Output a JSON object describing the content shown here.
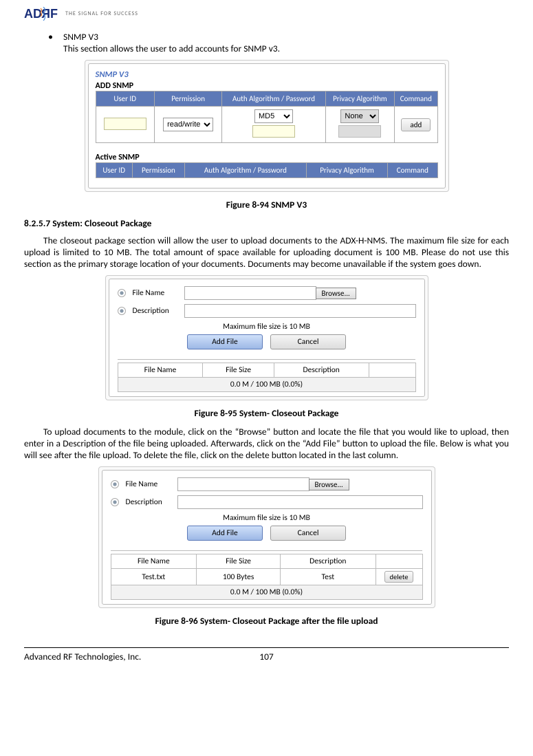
{
  "header": {
    "logo_text": "ADRF",
    "tagline": "THE SIGNAL FOR SUCCESS"
  },
  "section1": {
    "bullet_title": "SNMP V3",
    "bullet_body": "This section allows the user to add accounts for SNMP v3."
  },
  "snmp_panel": {
    "title": "SNMP V3",
    "add_label": "ADD SNMP",
    "headers": [
      "User ID",
      "Permission",
      "Auth Algorithm / Password",
      "Privacy Algorithm",
      "Command"
    ],
    "perm_value": "read/write",
    "auth_value": "MD5",
    "priv_value": "None",
    "add_btn": "add",
    "active_label": "Active SNMP"
  },
  "fig1": "Figure 8-94    SNMP V3",
  "section2": {
    "heading": "8.2.5.7    System: Closeout Package",
    "para": "The closeout package section will allow the user to upload documents to the ADX-H-NMS.  The maximum file size for each upload is limited to 10 MB.  The total amount of space available for uploading document is 100 MB.  Please do not use this section as the primary storage location of your documents.   Documents may become unavailable if the system goes down."
  },
  "closeout": {
    "file_label": "File Name",
    "desc_label": "Description",
    "browse": "Browse...",
    "max_text": "Maximum file size is 10 MB",
    "add_btn": "Add File",
    "cancel_btn": "Cancel",
    "cols": [
      "File Name",
      "File Size",
      "Description"
    ],
    "usage": "0.0 M / 100 MB (0.0%)"
  },
  "fig2": "Figure 8-95    System- Closeout Package",
  "para2": "To upload documents to the module, click on the “Browse” button and locate the file that you would like to upload, then enter in a Description of the file being uploaded.  Afterwards, click on the “Add File” button to upload the file.  Below is what you will see after the file upload.  To delete the file, click on the delete button located in the last column.",
  "closeout2": {
    "row": {
      "name": "Test.txt",
      "size": "100 Bytes",
      "desc": "Test"
    },
    "delete_btn": "delete"
  },
  "fig3": "Figure 8-96    System- Closeout Package after the file upload",
  "footer": {
    "company": "Advanced RF Technologies, Inc.",
    "page": "107"
  }
}
